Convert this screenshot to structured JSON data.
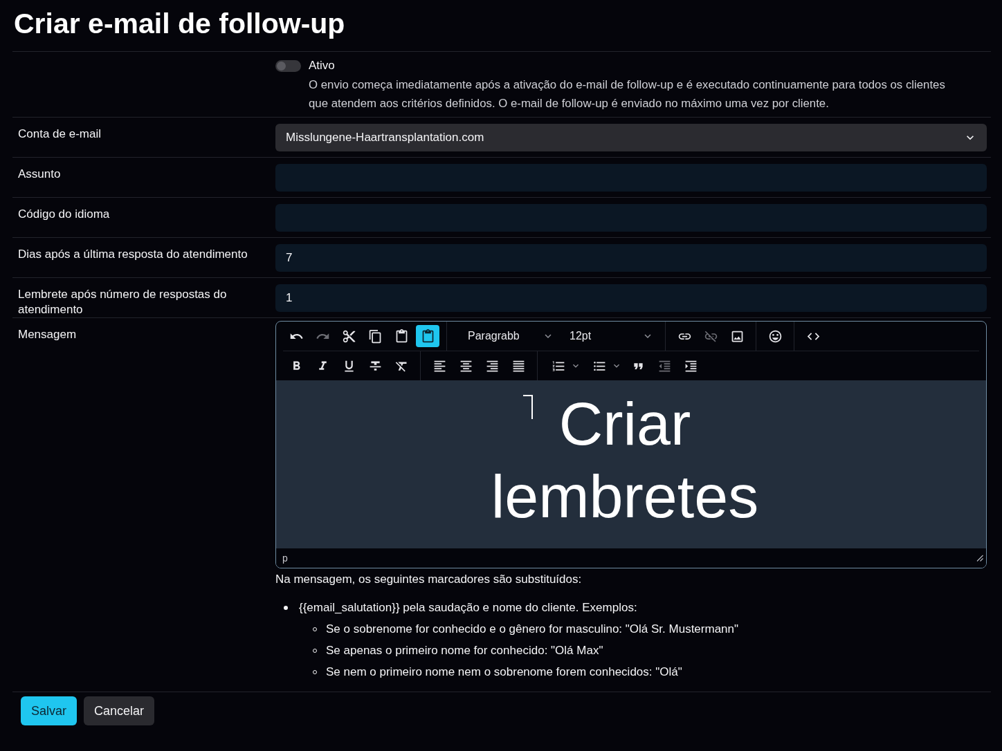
{
  "title": "Criar e-mail de follow-up",
  "activation": {
    "label": "Ativo",
    "on": false,
    "description": "O envio começa imediatamente após a ativação do e-mail de follow-up e é executado continuamente para todos os clientes que atendem aos critérios definidos. O e-mail de follow-up é enviado no máximo uma vez por cliente."
  },
  "fields": [
    {
      "label": "Conta de e-mail",
      "kind": "select",
      "value": "Misslungene-Haartransplantation.com"
    },
    {
      "label": "Assunto",
      "kind": "text"
    },
    {
      "label": "Código do idioma",
      "kind": "text"
    },
    {
      "label": "Dias após a última resposta do atendimento",
      "kind": "text",
      "value": "7"
    },
    {
      "label": "Lembrete após número de respostas do atendimento",
      "kind": "text",
      "value": "1"
    }
  ],
  "message": {
    "label": "Mensagem",
    "editor": {
      "toolbar": [
        [
          [
            {
              "kind": "undo",
              "disabled": false,
              "on": false
            },
            {
              "kind": "redo",
              "disabled": true,
              "on": false
            },
            {
              "kind": "cut",
              "disabled": false,
              "on": false
            },
            {
              "kind": "copy",
              "disabled": false,
              "on": false
            },
            {
              "kind": "paste",
              "disabled": false,
              "on": false
            },
            {
              "kind": "paste_text",
              "disabled": false,
              "on": true
            }
          ],
          [
            {
              "kind": "dropdown",
              "label": "Paragrabb",
              "disabled": false,
              "on": false
            },
            {
              "kind": "dropdown",
              "label": "12pt",
              "disabled": false,
              "on": false
            }
          ],
          [
            {
              "kind": "link",
              "disabled": false,
              "on": false
            },
            {
              "kind": "unlink",
              "disabled": true,
              "on": false
            },
            {
              "kind": "image",
              "disabled": false,
              "on": false
            }
          ],
          [
            {
              "kind": "emoji",
              "disabled": false,
              "on": false
            }
          ],
          [
            {
              "kind": "code",
              "disabled": false,
              "on": false
            }
          ]
        ],
        [
          [
            {
              "kind": "bold",
              "disabled": false,
              "on": false
            },
            {
              "kind": "italic",
              "disabled": false,
              "on": false
            },
            {
              "kind": "underline",
              "disabled": false,
              "on": false
            },
            {
              "kind": "strikethrough",
              "disabled": false,
              "on": false
            },
            {
              "kind": "clear_format",
              "disabled": false,
              "on": false
            }
          ],
          [
            {
              "kind": "align_left",
              "disabled": false,
              "on": false
            },
            {
              "kind": "align_center",
              "disabled": false,
              "on": false
            },
            {
              "kind": "align_right",
              "disabled": false,
              "on": false
            },
            {
              "kind": "justify",
              "disabled": false,
              "on": false
            }
          ],
          [
            {
              "kind": "numbered_list",
              "disabled": false,
              "on": false
            },
            {
              "kind": "bullet_list",
              "disabled": false,
              "on": false
            },
            {
              "kind": "blockquote",
              "disabled": false,
              "on": false
            },
            {
              "kind": "outdent",
              "disabled": true,
              "on": false
            },
            {
              "kind": "indent",
              "disabled": false,
              "on": false
            }
          ]
        ]
      ],
      "content": "Criar lembretes",
      "element_path": "p"
    },
    "help": {
      "intro": "Na mensagem, os seguintes marcadores são substituídos:",
      "items": [
        {
          "text": "{{email_salutation}} pela saudação e nome do cliente. Exemplos:",
          "children": [
            {
              "text": "Se o sobrenome for conhecido e o gênero for masculino: \"Olá Sr. Mustermann\""
            },
            {
              "text": "Se apenas o primeiro nome for conhecido: \"Olá Max\""
            },
            {
              "text": "Se nem o primeiro nome nem o sobrenome forem conhecidos: \"Olá\""
            }
          ]
        }
      ]
    }
  },
  "buttons": [
    {
      "label": "Salvar",
      "kind": "primary"
    },
    {
      "label": "Cancelar",
      "kind": "secondary"
    }
  ]
}
